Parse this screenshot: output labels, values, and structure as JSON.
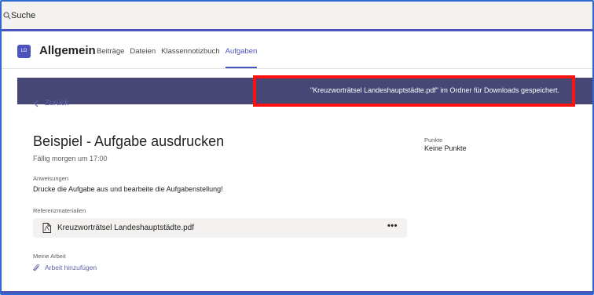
{
  "search": {
    "placeholder": "Suche",
    "icon": "search-icon"
  },
  "header": {
    "team_initials": "LD",
    "channel_title": "Allgemein",
    "tabs": [
      {
        "label": "Beiträge",
        "active": false
      },
      {
        "label": "Dateien",
        "active": false
      },
      {
        "label": "Klassennotizbuch",
        "active": false
      },
      {
        "label": "Aufgaben",
        "active": true
      }
    ]
  },
  "banner": {
    "message": "\"Kreuzworträtsel Landeshauptstädte.pdf\" im Ordner für Downloads gespeichert."
  },
  "assignment": {
    "back_label": "Zurück",
    "title": "Beispiel - Aufgabe ausdrucken",
    "due": "Fällig morgen um 17:00",
    "points_label": "Punkte",
    "points_value": "Keine Punkte",
    "instructions_label": "Anweisungen",
    "instructions_text": "Drucke die Aufgabe aus und bearbeite die Aufgabenstellung!",
    "reference_label": "Referenzmaterialien",
    "reference_file": "Kreuzworträtsel Landeshauptstädte.pdf",
    "more_label": "•••",
    "my_work_label": "Meine Arbeit",
    "add_work_label": "Arbeit hinzufügen"
  },
  "colors": {
    "accent": "#4b53bc",
    "banner": "#464775",
    "highlight": "#ff1212",
    "link": "#6264a7"
  }
}
